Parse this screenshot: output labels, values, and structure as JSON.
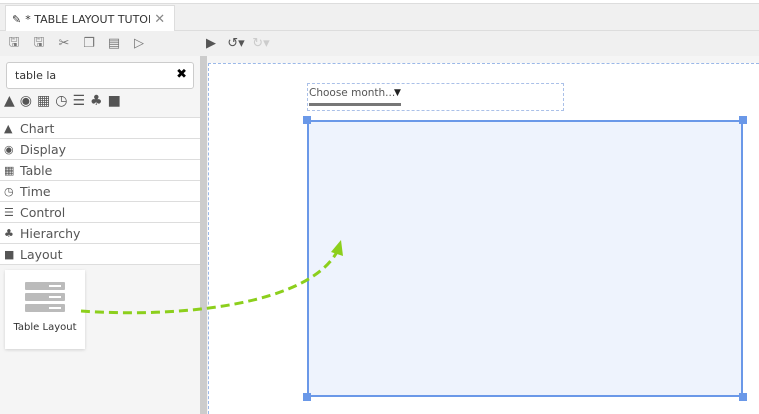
{
  "tab": {
    "title": "* TABLE LAYOUT TUTORIAL",
    "close": "✕"
  },
  "toolbar": [
    "save-icon",
    "save-as-icon",
    "cut-icon",
    "copy-icon",
    "paste-icon",
    "preview-icon",
    "run-icon",
    "undo-icon",
    "redo-icon"
  ],
  "search": {
    "value": "table la",
    "clear": "✖"
  },
  "categories": [
    {
      "icon": "▲",
      "label": "Chart"
    },
    {
      "icon": "◉",
      "label": "Display"
    },
    {
      "icon": "▦",
      "label": "Table"
    },
    {
      "icon": "◷",
      "label": "Time"
    },
    {
      "icon": "☰",
      "label": "Control"
    },
    {
      "icon": "♣",
      "label": "Hierarchy"
    },
    {
      "icon": "■",
      "label": "Layout"
    }
  ],
  "result": {
    "label": "Table Layout"
  },
  "canvas": {
    "select_value": "Choose month..."
  },
  "colors": {
    "accent": "#6a98e8",
    "arrow": "#8ccf1c"
  }
}
